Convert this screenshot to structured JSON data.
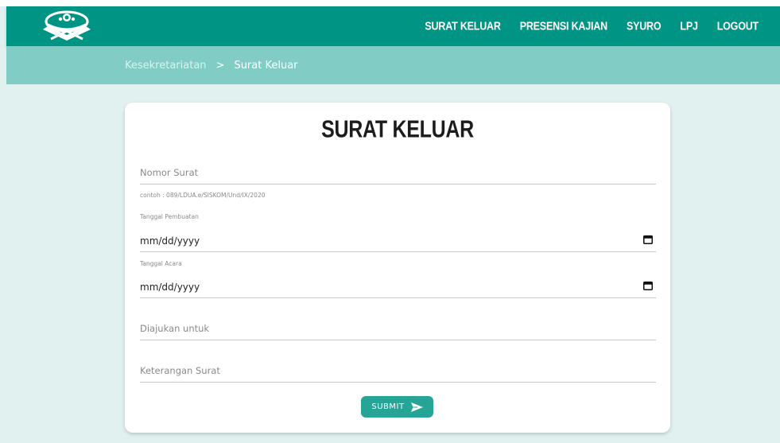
{
  "navbar": {
    "logo_icon": "quran-stand-logo-icon",
    "links": [
      {
        "label": "SURAT KELUAR"
      },
      {
        "label": "PRESENSI KAJIAN"
      },
      {
        "label": "SYURO"
      },
      {
        "label": "LPJ"
      },
      {
        "label": "LOGOUT"
      }
    ]
  },
  "breadcrumb": {
    "parent": "Kesekretariatan",
    "separator": ">",
    "current": "Surat Keluar"
  },
  "form": {
    "title": "SURAT KELUAR",
    "nomor_surat": {
      "placeholder": "Nomor Surat",
      "value": ""
    },
    "helper": "contoh : 089/LDUA.e/SISKOM/Und/IX/2020",
    "tanggal_pembuatan": {
      "label": "Tanggal Pembuatan",
      "value": "mm/dd/yyyy"
    },
    "tanggal_acara": {
      "label": "Tanggal Acara",
      "value": "mm/dd/yyyy"
    },
    "diajukan_untuk": {
      "placeholder": "Diajukan untuk",
      "value": ""
    },
    "keterangan_surat": {
      "placeholder": "Keterangan Surat",
      "value": ""
    },
    "submit_label": "SUBMIT",
    "submit_icon": "send-icon"
  },
  "colors": {
    "navbar": "#009485",
    "breadcrumb_bar": "#81cdc6",
    "background": "#e1f1f0",
    "submit": "#26a597"
  }
}
